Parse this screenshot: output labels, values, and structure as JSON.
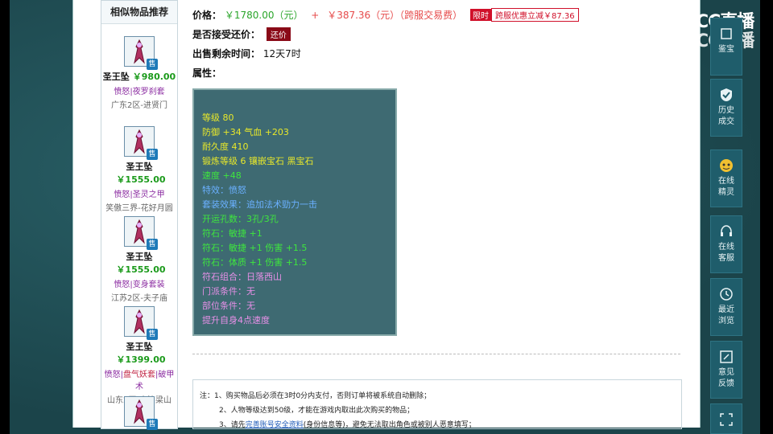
{
  "sidebar": {
    "title": "相似物品推荐",
    "sale_badge": "售",
    "items": [
      {
        "name": "圣王坠",
        "price": "￥980.00",
        "tag1": "愤怒",
        "sep": "|",
        "tag2": "夜罗刹套",
        "server": "广东2区-进贤门"
      },
      {
        "name": "圣王坠",
        "price": "￥1555.00",
        "tag1": "愤怒",
        "sep": "|",
        "tag2": "圣灵之甲",
        "server": "笑傲三界-花好月圆"
      },
      {
        "name": "圣王坠",
        "price": "￥1555.00",
        "tag1": "愤怒",
        "sep": "|",
        "tag2": "变身套装",
        "server": "江苏2区-夫子庙"
      },
      {
        "name": "圣王坠",
        "price": "￥1399.00",
        "tag1": "愤怒",
        "sep": "|",
        "tag2": "盘气妖套",
        "tag3": "|破甲术",
        "server": "山东2区-水泊梁山"
      },
      {
        "name": "",
        "price": "",
        "tag1": "",
        "sep": "",
        "tag2": "",
        "server": ""
      }
    ]
  },
  "detail": {
    "price_label": "价格：",
    "price_main": "￥1780.00（元）",
    "plus": "+",
    "price_fee": "￥387.36（元）（跨服交易费）",
    "limit_badge": "限时",
    "discount_text": "跨服优惠立减￥87.36",
    "counter_label": "是否接受还价：",
    "counter_btn": "还价",
    "remain_label": "出售剩余时间：",
    "remain_value": "12天7时",
    "attr_label": "属性："
  },
  "attributes": [
    {
      "text": "等级 80",
      "color": "y"
    },
    {
      "text": "防御 +34 气血 +203",
      "color": "y"
    },
    {
      "text": "耐久度 410",
      "color": "y"
    },
    {
      "text": "锻炼等级 6 镶嵌宝石 黑宝石",
      "color": "y"
    },
    {
      "text": "速度 +48",
      "color": "g"
    },
    {
      "text": "特效：愤怒",
      "color": "b"
    },
    {
      "text": "套装效果：追加法术勁力一击",
      "color": "b"
    },
    {
      "text": "开运孔数：3孔/3孔",
      "color": "g"
    },
    {
      "text": "符石：敏捷 +1",
      "color": "g"
    },
    {
      "text": "符石：敏捷 +1 伤害 +1.5",
      "color": "g"
    },
    {
      "text": "符石：体质 +1 伤害 +1.5",
      "color": "g"
    },
    {
      "text": "符石组合：日落西山",
      "color": "p"
    },
    {
      "text": "门派条件：无",
      "color": "p"
    },
    {
      "text": "部位条件：无",
      "color": "p"
    },
    {
      "text": "提升自身4点速度",
      "color": "p"
    }
  ],
  "notes": {
    "line1": "注：1、购买物品后必须在3时0分内支付，否则订单将被系统自动删除；",
    "line2": "2、人物等级达到50级，才能在游戏内取出此次购买的物品；",
    "line3_prefix": "3、请先",
    "line3_link": "完善账号安全资料",
    "line3_suffix": "(身份信息等)，避免无法取出角色或被别人恶意填写；"
  },
  "logo": {
    "text": "CC直播"
  },
  "right_panel": [
    {
      "label1": "鉴宝",
      "label2": "",
      "icon": "appraise-icon"
    },
    {
      "label1": "历史",
      "label2": "成交",
      "icon": "shield-icon"
    },
    {
      "label1": "在线",
      "label2": "精灵",
      "icon": "sprite-avatar-icon"
    },
    {
      "label1": "在线",
      "label2": "客服",
      "icon": "headset-icon"
    },
    {
      "label1": "最近",
      "label2": "浏览",
      "icon": "clock-icon"
    },
    {
      "label1": "意见",
      "label2": "反馈",
      "icon": "edit-icon"
    },
    {
      "label1": "",
      "label2": "",
      "icon": "scan-icon"
    }
  ]
}
